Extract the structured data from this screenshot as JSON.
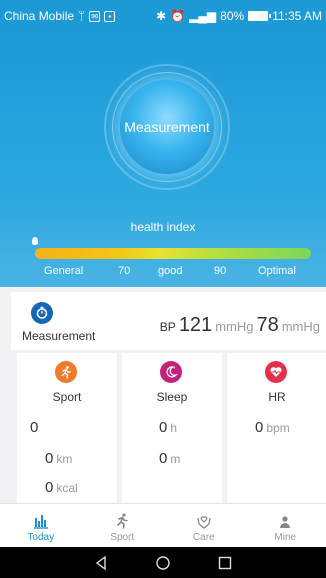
{
  "status_bar": {
    "carrier": "China Mobile",
    "battery": "80%",
    "time": "11:35 AM"
  },
  "hero": {
    "orb_label": "Measurement",
    "health_label": "health index",
    "scale": {
      "general": "General",
      "low": "70",
      "good": "good",
      "high": "90",
      "optimal": "Optimal"
    }
  },
  "measurement": {
    "label": "Measurement",
    "bp_prefix": "BP",
    "systolic": "121",
    "systolic_unit": "mmHg",
    "diastolic": "78",
    "diastolic_unit": "mmHg"
  },
  "sport": {
    "title": "Sport",
    "steps": "0",
    "distance": "0",
    "distance_unit": "km",
    "calories": "0",
    "calories_unit": "kcal"
  },
  "sleep": {
    "title": "Sleep",
    "hours": "0",
    "hours_unit": "h",
    "minutes": "0",
    "minutes_unit": "m"
  },
  "hr": {
    "title": "HR",
    "value": "0",
    "unit": "bpm"
  },
  "tabs": [
    {
      "label": "Today",
      "icon": "bar-chart-icon",
      "active": true
    },
    {
      "label": "Sport",
      "icon": "running-icon",
      "active": false
    },
    {
      "label": "Care",
      "icon": "heart-hands-icon",
      "active": false
    },
    {
      "label": "Mine",
      "icon": "person-icon",
      "active": false
    }
  ],
  "colors": {
    "primary": "#1c9ad6",
    "sport": "#f07a2a",
    "sleep": "#c2227c",
    "hr": "#e2314a",
    "measurement": "#1566b5"
  }
}
